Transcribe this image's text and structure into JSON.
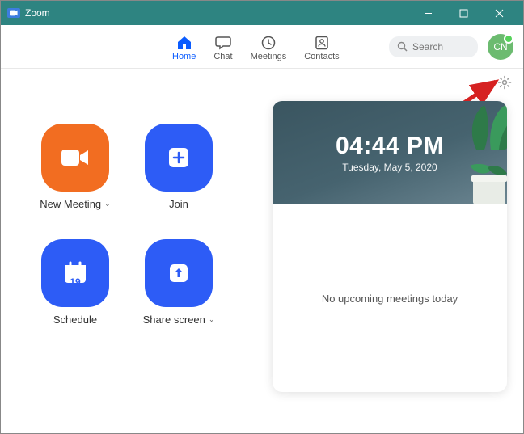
{
  "window": {
    "title": "Zoom"
  },
  "nav": {
    "home": "Home",
    "chat": "Chat",
    "meetings": "Meetings",
    "contacts": "Contacts",
    "search_placeholder": "Search"
  },
  "avatar": {
    "initials": "CN"
  },
  "actions": {
    "new_meeting": "New Meeting",
    "join": "Join",
    "schedule": "Schedule",
    "schedule_day": "19",
    "share_screen": "Share screen"
  },
  "clock": {
    "time": "04:44 PM",
    "date": "Tuesday, May 5, 2020"
  },
  "upcoming": {
    "empty_text": "No upcoming meetings today"
  }
}
